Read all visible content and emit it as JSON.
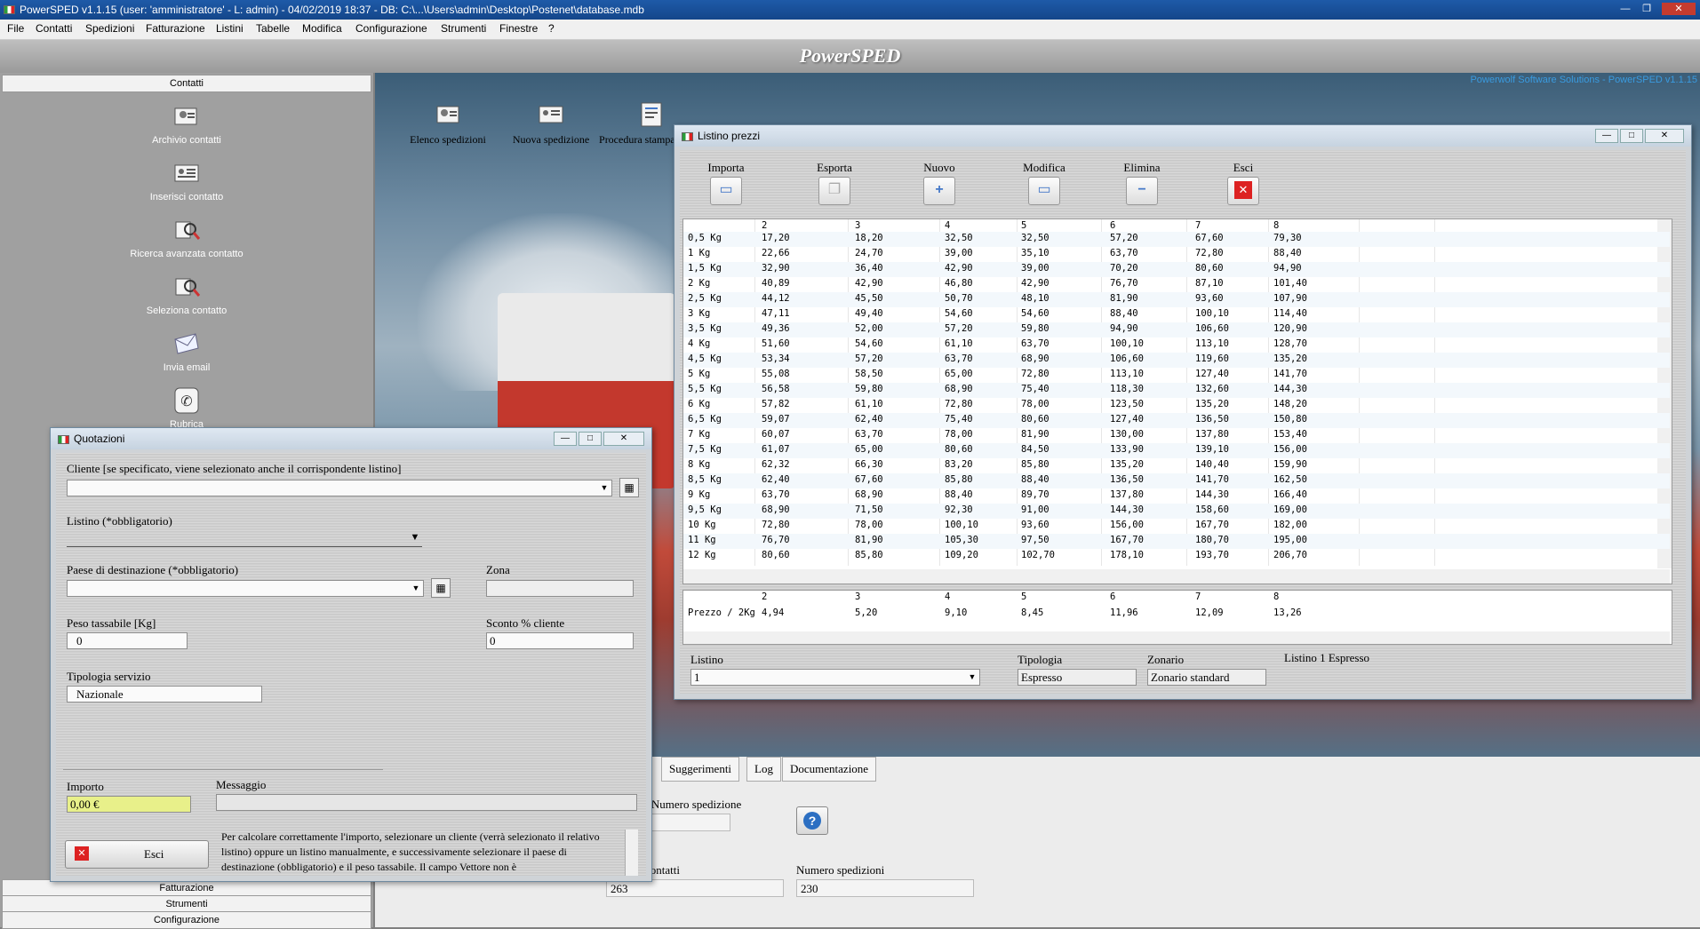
{
  "app_title": "PowerSPED v1.1.15  (user: 'amministratore'  - L: admin) - 04/02/2019 18:37 - DB: C:\\...\\Users\\admin\\Desktop\\Postenet\\database.mdb",
  "menu": [
    "File",
    "Contatti",
    "Spedizioni",
    "Fatturazione",
    "Listini",
    "Tabelle",
    "Modifica",
    "Configurazione",
    "Strumenti",
    "Finestre",
    "?"
  ],
  "banner": "PowerSPED",
  "brand": "Powerwolf Software Solutions - PowerSPED v1.1.15",
  "sidebar": {
    "header": "Contatti",
    "items": [
      "Archivio contatti",
      "Inserisci contatto",
      "Ricerca avanzata contatto",
      "Seleziona contatto",
      "Invia email",
      "Rubrica"
    ],
    "bottom_sections": [
      "Fatturazione",
      "Strumenti",
      "Configurazione"
    ]
  },
  "desktop_icons": [
    "Elenco spedizioni",
    "Nuova spedizione",
    "Procedura stampa fatture"
  ],
  "listino": {
    "title": "Listino prezzi",
    "toolbar": [
      "Importa",
      "Esporta",
      "Nuovo",
      "Modifica",
      "Elimina",
      "Esci"
    ],
    "columns": [
      "",
      "2",
      "3",
      "4",
      "5",
      "6",
      "7",
      "8"
    ],
    "rows": [
      [
        "0,5 Kg",
        "17,20",
        "18,20",
        "32,50",
        "32,50",
        "57,20",
        "67,60",
        "79,30"
      ],
      [
        "1 Kg",
        "22,66",
        "24,70",
        "39,00",
        "35,10",
        "63,70",
        "72,80",
        "88,40"
      ],
      [
        "1,5 Kg",
        "32,90",
        "36,40",
        "42,90",
        "39,00",
        "70,20",
        "80,60",
        "94,90"
      ],
      [
        "2 Kg",
        "40,89",
        "42,90",
        "46,80",
        "42,90",
        "76,70",
        "87,10",
        "101,40"
      ],
      [
        "2,5 Kg",
        "44,12",
        "45,50",
        "50,70",
        "48,10",
        "81,90",
        "93,60",
        "107,90"
      ],
      [
        "3 Kg",
        "47,11",
        "49,40",
        "54,60",
        "54,60",
        "88,40",
        "100,10",
        "114,40"
      ],
      [
        "3,5 Kg",
        "49,36",
        "52,00",
        "57,20",
        "59,80",
        "94,90",
        "106,60",
        "120,90"
      ],
      [
        "4 Kg",
        "51,60",
        "54,60",
        "61,10",
        "63,70",
        "100,10",
        "113,10",
        "128,70"
      ],
      [
        "4,5 Kg",
        "53,34",
        "57,20",
        "63,70",
        "68,90",
        "106,60",
        "119,60",
        "135,20"
      ],
      [
        "5 Kg",
        "55,08",
        "58,50",
        "65,00",
        "72,80",
        "113,10",
        "127,40",
        "141,70"
      ],
      [
        "5,5 Kg",
        "56,58",
        "59,80",
        "68,90",
        "75,40",
        "118,30",
        "132,60",
        "144,30"
      ],
      [
        "6 Kg",
        "57,82",
        "61,10",
        "72,80",
        "78,00",
        "123,50",
        "135,20",
        "148,20"
      ],
      [
        "6,5 Kg",
        "59,07",
        "62,40",
        "75,40",
        "80,60",
        "127,40",
        "136,50",
        "150,80"
      ],
      [
        "7 Kg",
        "60,07",
        "63,70",
        "78,00",
        "81,90",
        "130,00",
        "137,80",
        "153,40"
      ],
      [
        "7,5 Kg",
        "61,07",
        "65,00",
        "80,60",
        "84,50",
        "133,90",
        "139,10",
        "156,00"
      ],
      [
        "8 Kg",
        "62,32",
        "66,30",
        "83,20",
        "85,80",
        "135,20",
        "140,40",
        "159,90"
      ],
      [
        "8,5 Kg",
        "62,40",
        "67,60",
        "85,80",
        "88,40",
        "136,50",
        "141,70",
        "162,50"
      ],
      [
        "9 Kg",
        "63,70",
        "68,90",
        "88,40",
        "89,70",
        "137,80",
        "144,30",
        "166,40"
      ],
      [
        "9,5 Kg",
        "68,90",
        "71,50",
        "92,30",
        "91,00",
        "144,30",
        "158,60",
        "169,00"
      ],
      [
        "10 Kg",
        "72,80",
        "78,00",
        "100,10",
        "93,60",
        "156,00",
        "167,70",
        "182,00"
      ],
      [
        "11 Kg",
        "76,70",
        "81,90",
        "105,30",
        "97,50",
        "167,70",
        "180,70",
        "195,00"
      ],
      [
        "12 Kg",
        "80,60",
        "85,80",
        "109,20",
        "102,70",
        "178,10",
        "193,70",
        "206,70"
      ]
    ],
    "extra_columns": [
      "",
      "2",
      "3",
      "4",
      "5",
      "6",
      "7",
      "8"
    ],
    "extra_row": [
      "Prezzo / 2Kg",
      "4,94",
      "5,20",
      "9,10",
      "8,45",
      "11,96",
      "12,09",
      "13,26"
    ],
    "listino_label": "Listino",
    "listino_value": "1",
    "tipologia_label": "Tipologia",
    "tipologia_value": "Espresso",
    "zonario_label": "Zonario",
    "zonario_value": "Zonario standard",
    "description": "Listino 1 Espresso"
  },
  "quotazioni": {
    "title": "Quotazioni",
    "cliente_label": "Cliente [se specificato, viene selezionato anche il corrispondente listino]",
    "listino_label": "Listino (*obbligatorio)",
    "paese_label": "Paese di destinazione (*obbligatorio)",
    "zona_label": "Zona",
    "peso_label": "Peso tassabile [Kg]",
    "peso_value": "0",
    "sconto_label": "Sconto % cliente",
    "sconto_value": "0",
    "tipologia_label": "Tipologia servizio",
    "tipologia_value": "Nazionale",
    "importo_label": "Importo",
    "importo_value": "0,00 €",
    "messaggio_label": "Messaggio",
    "esci_label": "Esci",
    "help_text": "Per calcolare correttamente l'importo, selezionare un cliente (verrà selezionato il relativo listino) oppure un listino manualmente, e successivamente selezionare il paese di destinazione (obbligatorio) e il peso tassabile. Il campo Vettore non è"
  },
  "bottom": {
    "tabs": [
      "Suggerimenti",
      "Log",
      "Documentazione"
    ],
    "numero_spedizione_label": "/ Numero spedizione",
    "contatti_label": "contatti",
    "contatti_value": "263",
    "numero_spedizioni_label": "Numero spedizioni",
    "numero_spedizioni_value": "230"
  }
}
